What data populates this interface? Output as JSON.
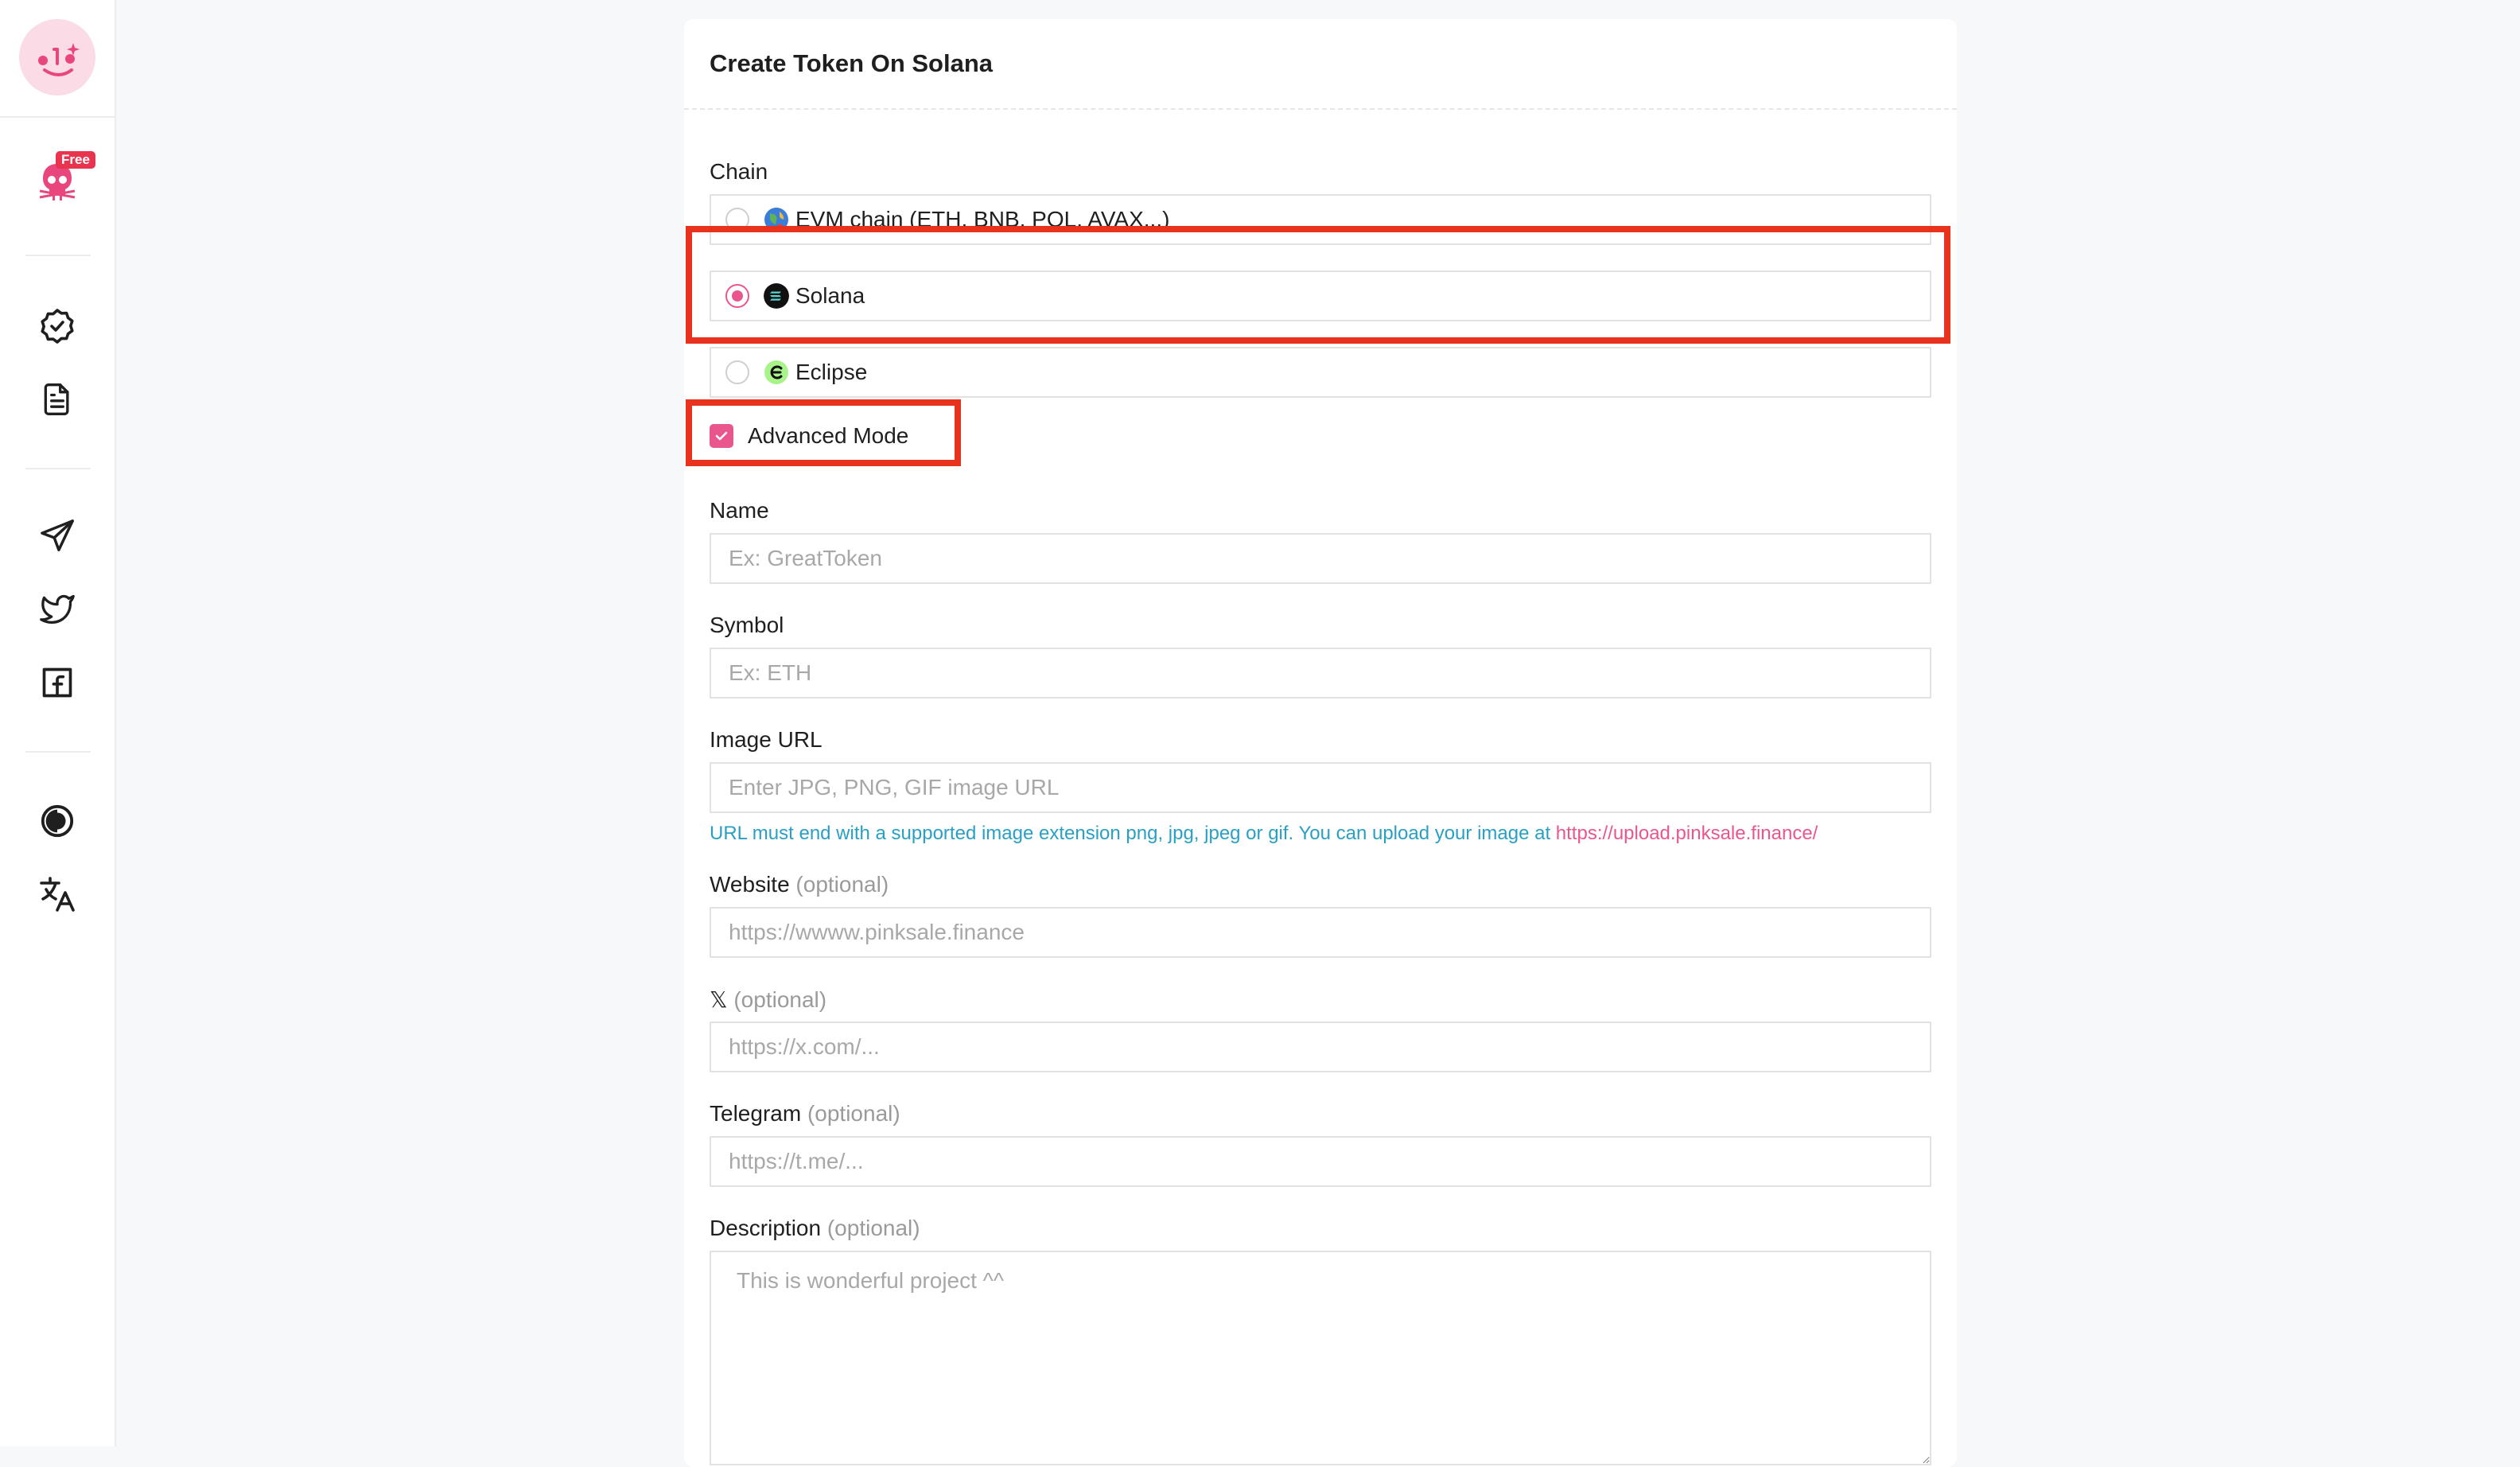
{
  "sidebar": {
    "free_badge": "Free",
    "icons": [
      "logo-icon",
      "skull-icon",
      "verified-badge-icon",
      "document-icon",
      "telegram-icon",
      "twitter-icon",
      "facebook-icon",
      "theme-toggle-icon",
      "translate-icon"
    ]
  },
  "form": {
    "title": "Create Token On Solana",
    "chain_label": "Chain",
    "chain_options": [
      {
        "label": "EVM chain (ETH, BNB, POL, AVAX...)",
        "selected": false
      },
      {
        "label": "Solana",
        "selected": true
      },
      {
        "label": "Eclipse",
        "selected": false
      }
    ],
    "advanced_mode": {
      "label": "Advanced Mode",
      "checked": true
    },
    "name": {
      "label": "Name",
      "placeholder": "Ex: GreatToken"
    },
    "symbol": {
      "label": "Symbol",
      "placeholder": "Ex: ETH"
    },
    "image_url": {
      "label": "Image URL",
      "placeholder": "Enter JPG, PNG, GIF image URL",
      "hint": "URL must end with a supported image extension png, jpg, jpeg or gif. You can upload your image at ",
      "hint_link": "https://upload.pinksale.finance/"
    },
    "website": {
      "label": "Website",
      "optional": "(optional)",
      "placeholder": "https://wwww.pinksale.finance"
    },
    "x": {
      "label": "𝕏",
      "optional": "(optional)",
      "placeholder": "https://x.com/..."
    },
    "telegram": {
      "label": "Telegram",
      "optional": "(optional)",
      "placeholder": "https://t.me/..."
    },
    "description": {
      "label": "Description",
      "optional": "(optional)",
      "placeholder": "This is wonderful project ^^"
    }
  },
  "colors": {
    "accent": "#e9568e",
    "highlight": "#e8321e",
    "hint": "#2a9fc4"
  }
}
